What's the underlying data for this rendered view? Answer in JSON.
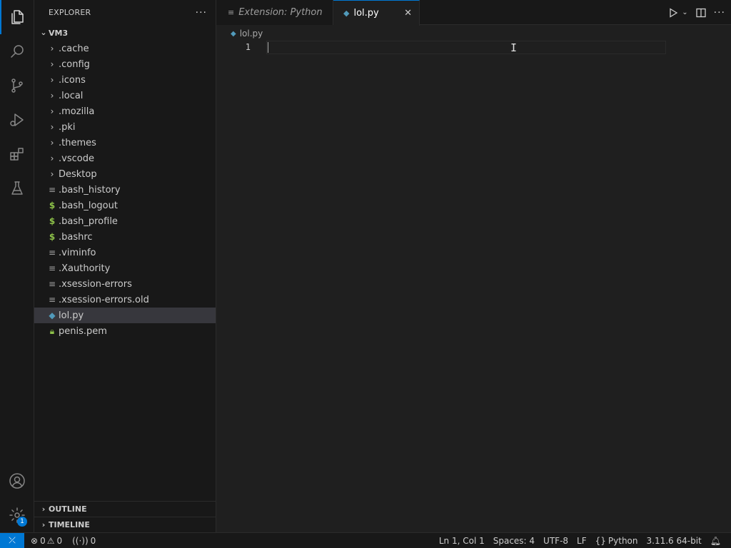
{
  "sidebar": {
    "title": "EXPLORER",
    "more": "···",
    "root": "VM3",
    "items": [
      {
        "label": ".cache",
        "kind": "folder"
      },
      {
        "label": ".config",
        "kind": "folder"
      },
      {
        "label": ".icons",
        "kind": "folder"
      },
      {
        "label": ".local",
        "kind": "folder"
      },
      {
        "label": ".mozilla",
        "kind": "folder"
      },
      {
        "label": ".pki",
        "kind": "folder"
      },
      {
        "label": ".themes",
        "kind": "folder"
      },
      {
        "label": ".vscode",
        "kind": "folder"
      },
      {
        "label": "Desktop",
        "kind": "folder"
      },
      {
        "label": ".bash_history",
        "kind": "text"
      },
      {
        "label": ".bash_logout",
        "kind": "shell"
      },
      {
        "label": ".bash_profile",
        "kind": "shell"
      },
      {
        "label": ".bashrc",
        "kind": "shell"
      },
      {
        "label": ".viminfo",
        "kind": "text"
      },
      {
        "label": ".Xauthority",
        "kind": "text"
      },
      {
        "label": ".xsession-errors",
        "kind": "text"
      },
      {
        "label": ".xsession-errors.old",
        "kind": "text"
      },
      {
        "label": "lol.py",
        "kind": "python",
        "selected": true
      },
      {
        "label": "penis.pem",
        "kind": "key"
      }
    ],
    "outline": "OUTLINE",
    "timeline": "TIMELINE"
  },
  "tabs": [
    {
      "label": "Extension: Python",
      "active": false
    },
    {
      "label": "lol.py",
      "active": true
    }
  ],
  "editor": {
    "breadcrumb": "lol.py",
    "line_number": "1"
  },
  "status": {
    "errors": "0",
    "warnings": "0",
    "ports": "0",
    "position": "Ln 1, Col 1",
    "spaces": "Spaces: 4",
    "encoding": "UTF-8",
    "eol": "LF",
    "language": "Python",
    "interpreter": "3.11.6 64-bit"
  },
  "activity": {
    "badge": "1"
  },
  "colors": {
    "accent": "#0078d4",
    "python": "#519aba",
    "shell": "#8dc149"
  }
}
